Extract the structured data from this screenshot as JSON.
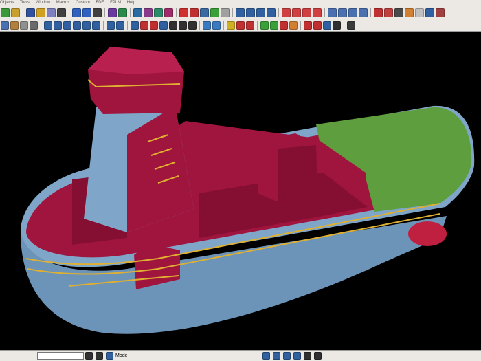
{
  "menubar": {
    "items": [
      "Objects",
      "Tools",
      "Window",
      "Macros",
      "Custom",
      "FDE",
      "FPLM",
      "Help"
    ]
  },
  "toolbar_row1": {
    "icons": [
      {
        "n": "filter-icon",
        "c": "#3a9a3a"
      },
      {
        "n": "select-icon",
        "c": "#c8a030"
      },
      {
        "sep": true
      },
      {
        "n": "save-icon",
        "c": "#3050a0"
      },
      {
        "n": "lock-icon",
        "c": "#d0a020"
      },
      {
        "n": "copy-icon",
        "c": "#8080c0"
      },
      {
        "n": "binoculars-icon",
        "c": "#404040"
      },
      {
        "sep": true
      },
      {
        "n": "undo-icon",
        "c": "#3060c0"
      },
      {
        "n": "redo-icon",
        "c": "#3060c0"
      },
      {
        "n": "refresh-icon",
        "c": "#404040"
      },
      {
        "sep": true
      },
      {
        "n": "model-view-icon",
        "c": "#6a3aa0"
      },
      {
        "n": "model-add-icon",
        "c": "#2a8a4a"
      },
      {
        "sep": true
      },
      {
        "n": "model-select-icon",
        "c": "#2a6aa0"
      },
      {
        "n": "model-edit-icon",
        "c": "#8a3a8a"
      },
      {
        "n": "model-check-icon",
        "c": "#2a8a6a"
      },
      {
        "n": "model-delete-icon",
        "c": "#a02a6a"
      },
      {
        "sep": true
      },
      {
        "n": "check-icon",
        "c": "#d03030"
      },
      {
        "n": "measure-icon",
        "c": "#c03030"
      },
      {
        "n": "hierarchy-icon",
        "c": "#3a6aa0"
      },
      {
        "n": "navigate-icon",
        "c": "#3aa03a"
      },
      {
        "n": "tag-icon",
        "c": "#a0a0a0"
      },
      {
        "sep": true
      },
      {
        "n": "assembly-icon",
        "c": "#3060a0"
      },
      {
        "n": "assembly-add-icon",
        "c": "#3060a0"
      },
      {
        "n": "assembly-part-icon",
        "c": "#3060a0"
      },
      {
        "n": "assembly-tree-icon",
        "c": "#3060a0"
      },
      {
        "sep": true
      },
      {
        "n": "grid-red-icon",
        "c": "#d04040"
      },
      {
        "n": "grid-red-alt-icon",
        "c": "#d04040"
      },
      {
        "n": "grid-red-add-icon",
        "c": "#d04040"
      },
      {
        "n": "grid-red-edit-icon",
        "c": "#d04040"
      },
      {
        "sep": true
      },
      {
        "n": "window-icon",
        "c": "#4a70b0"
      },
      {
        "n": "window-split-icon",
        "c": "#4a70b0"
      },
      {
        "n": "window-tile-icon",
        "c": "#4a70b0"
      },
      {
        "n": "window-cascade-icon",
        "c": "#4a70b0"
      },
      {
        "sep": true
      },
      {
        "n": "help-icon",
        "c": "#c03030"
      },
      {
        "n": "document-icon",
        "c": "#c04040"
      },
      {
        "n": "report-icon",
        "c": "#4a4a4a"
      },
      {
        "n": "book-icon",
        "c": "#d08030"
      },
      {
        "n": "page-icon",
        "c": "#c0c0c0"
      },
      {
        "n": "page-view-icon",
        "c": "#3060a0"
      },
      {
        "n": "page-edit-icon",
        "c": "#a04040"
      }
    ]
  },
  "toolbar_row2": {
    "icons": [
      {
        "n": "layer-icon",
        "c": "#4a70b0"
      },
      {
        "n": "box-icon",
        "c": "#b08040"
      },
      {
        "n": "hide-icon",
        "c": "#909090"
      },
      {
        "n": "db-icon",
        "c": "#6a6a6a"
      },
      {
        "sep": true
      },
      {
        "n": "ruler-icon",
        "c": "#3060a0"
      },
      {
        "n": "angle-icon",
        "c": "#3060a0"
      },
      {
        "n": "axis-icon",
        "c": "#3060a0"
      },
      {
        "n": "bracket-icon",
        "c": "#3060a0"
      },
      {
        "n": "line-icon",
        "c": "#3060a0"
      },
      {
        "n": "curve-icon",
        "c": "#3060a0"
      },
      {
        "sep": true
      },
      {
        "n": "dots-icon",
        "c": "#3060a0"
      },
      {
        "n": "grid-dots-icon",
        "c": "#3060a0"
      },
      {
        "sep": true
      },
      {
        "n": "pointer-icon",
        "c": "#3060a0"
      },
      {
        "n": "point-add-icon",
        "c": "#c03030"
      },
      {
        "n": "point-edit-icon",
        "c": "#c03030"
      },
      {
        "n": "vertex-icon",
        "c": "#3060a0"
      },
      {
        "n": "polyline-icon",
        "c": "#303030"
      },
      {
        "n": "snap-icon",
        "c": "#303030"
      },
      {
        "n": "path-icon",
        "c": "#303030"
      },
      {
        "sep": true
      },
      {
        "n": "sync-icon",
        "c": "#3a7ac0"
      },
      {
        "n": "circle-icon",
        "c": "#3a7ac0"
      },
      {
        "sep": true
      },
      {
        "n": "flag-icon",
        "c": "#d0b020"
      },
      {
        "n": "arrow-right-icon",
        "c": "#c03030"
      },
      {
        "n": "arrow-down-icon",
        "c": "#c03030"
      },
      {
        "sep": true
      },
      {
        "n": "split-icon",
        "c": "#3aa03a"
      },
      {
        "n": "merge-icon",
        "c": "#3aa03a"
      },
      {
        "n": "tool-icon",
        "c": "#c03030"
      },
      {
        "n": "gear-icon",
        "c": "#d08030"
      },
      {
        "sep": true
      },
      {
        "n": "import-icon",
        "c": "#c03030"
      },
      {
        "n": "export-icon",
        "c": "#c03030"
      },
      {
        "n": "transfer-icon",
        "c": "#3060a0"
      },
      {
        "n": "attach-icon",
        "c": "#303030"
      },
      {
        "sep": true
      },
      {
        "n": "checkmark-icon",
        "c": "#3a3a3a"
      }
    ]
  },
  "statusbar": {
    "input_value": "",
    "mode_label": "Mode",
    "icons_left": [
      {
        "n": "cursor-icon",
        "c": "#303030"
      },
      {
        "n": "camera-icon",
        "c": "#303030"
      },
      {
        "n": "layers-status-icon",
        "c": "#3060a0"
      }
    ],
    "icons_right": [
      {
        "n": "ruler-status-icon",
        "c": "#3060a0"
      },
      {
        "n": "tree-status-icon",
        "c": "#3060a0"
      },
      {
        "n": "grid-status-icon",
        "c": "#3060a0"
      },
      {
        "n": "network-icon",
        "c": "#3060a0"
      },
      {
        "n": "nav-status-icon",
        "c": "#303030"
      },
      {
        "n": "snap-status-icon",
        "c": "#303030"
      }
    ]
  },
  "colors": {
    "hull": "#7fa6c9",
    "deck": "#a0153e",
    "foredeck": "#5e9e3e",
    "fittings": "#e0b030",
    "background": "#000000",
    "propeller": "#c02040"
  }
}
